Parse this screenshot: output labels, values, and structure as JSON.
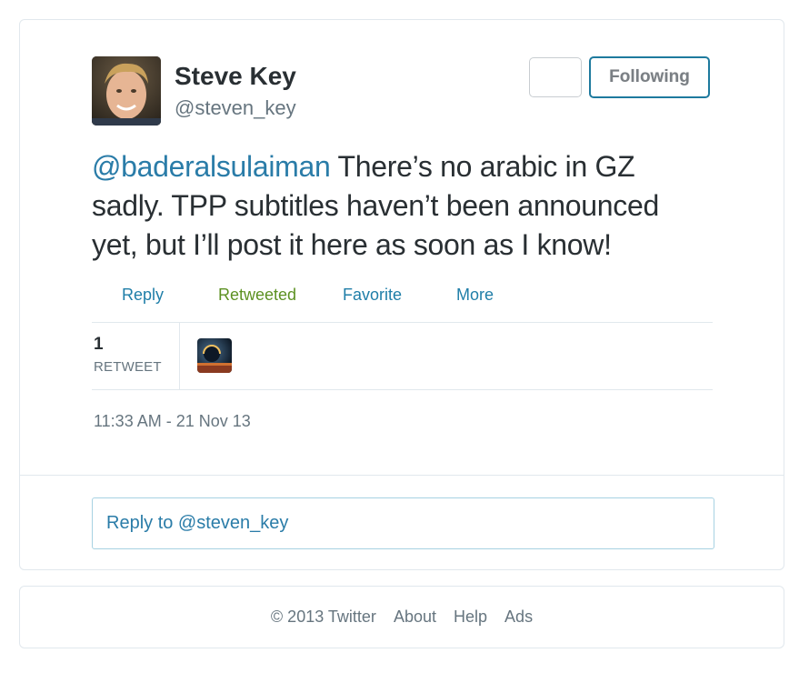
{
  "tweet": {
    "author": {
      "name": "Steve Key",
      "handle": "@steven_key",
      "avatar": "profile-photo"
    },
    "follow_button_label": "Following",
    "text_mention": "@baderalsulaiman",
    "text_line1_rest": " There’s no arabic in GZ",
    "text_line2": "sadly. TPP subtitles haven’t been announced",
    "text_line3": "yet, but I’ll post it here as soon as I know!",
    "actions": {
      "reply": "Reply",
      "retweeted": "Retweeted",
      "favorite": "Favorite",
      "more": "More"
    },
    "stats": {
      "retweet_count": "1",
      "retweet_label": "RETWEET"
    },
    "timestamp": "11:33 AM - 21 Nov 13",
    "reply_placeholder": "Reply to @steven_key"
  },
  "footer": {
    "copyright": "© 2013 Twitter",
    "about": "About",
    "help": "Help",
    "ads": "Ads"
  },
  "colors": {
    "link": "#2a7ca8",
    "retweeted": "#5c9122",
    "text": "#292f33",
    "muted": "#66757f"
  }
}
